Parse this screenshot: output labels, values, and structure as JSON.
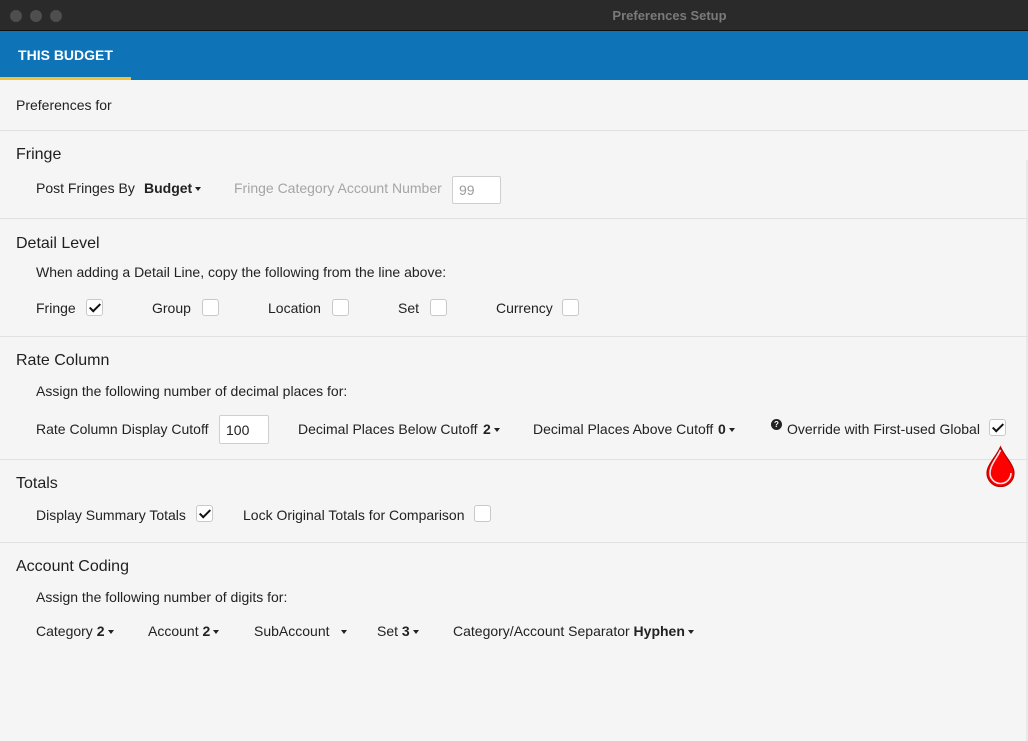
{
  "window": {
    "title": "Preferences Setup"
  },
  "tabs": [
    {
      "label": "THIS BUDGET",
      "active": true
    }
  ],
  "preferences_for": "Preferences for",
  "fringe": {
    "heading": "Fringe",
    "post_by_label": "Post Fringes By",
    "post_by_value": "Budget",
    "category_account_label": "Fringe Category Account Number",
    "category_account_value": "99"
  },
  "detail": {
    "heading": "Detail Level",
    "intro": "When adding a Detail Line, copy the following from the line above:",
    "options": [
      {
        "label": "Fringe",
        "checked": true
      },
      {
        "label": "Group",
        "checked": false
      },
      {
        "label": "Location",
        "checked": false
      },
      {
        "label": "Set",
        "checked": false
      },
      {
        "label": "Currency",
        "checked": false
      }
    ]
  },
  "rate": {
    "heading": "Rate Column",
    "intro": "Assign the following number of decimal places for:",
    "cutoff_label": "Rate Column Display Cutoff",
    "cutoff_value": "100",
    "below_label": "Decimal Places Below Cutoff",
    "below_value": "2",
    "above_label": "Decimal Places Above Cutoff",
    "above_value": "0",
    "override_label": "Override with First-used Global",
    "override_checked": true
  },
  "totals": {
    "heading": "Totals",
    "display_label": "Display Summary Totals",
    "display_checked": true,
    "lock_label": "Lock Original Totals for Comparison",
    "lock_checked": false
  },
  "account": {
    "heading": "Account Coding",
    "intro": "Assign the following number of digits for:",
    "category_label": "Category",
    "category_value": "2",
    "account_label": "Account",
    "account_value": "2",
    "subaccount_label": "SubAccount",
    "subaccount_value": "",
    "set_label": "Set",
    "set_value": "3",
    "separator_label": "Category/Account Separator",
    "separator_value": "Hyphen"
  },
  "colors": {
    "tab_bar": "#0f73b7",
    "tab_underline": "#f2c233",
    "cursor_marker": "#ff0000"
  }
}
